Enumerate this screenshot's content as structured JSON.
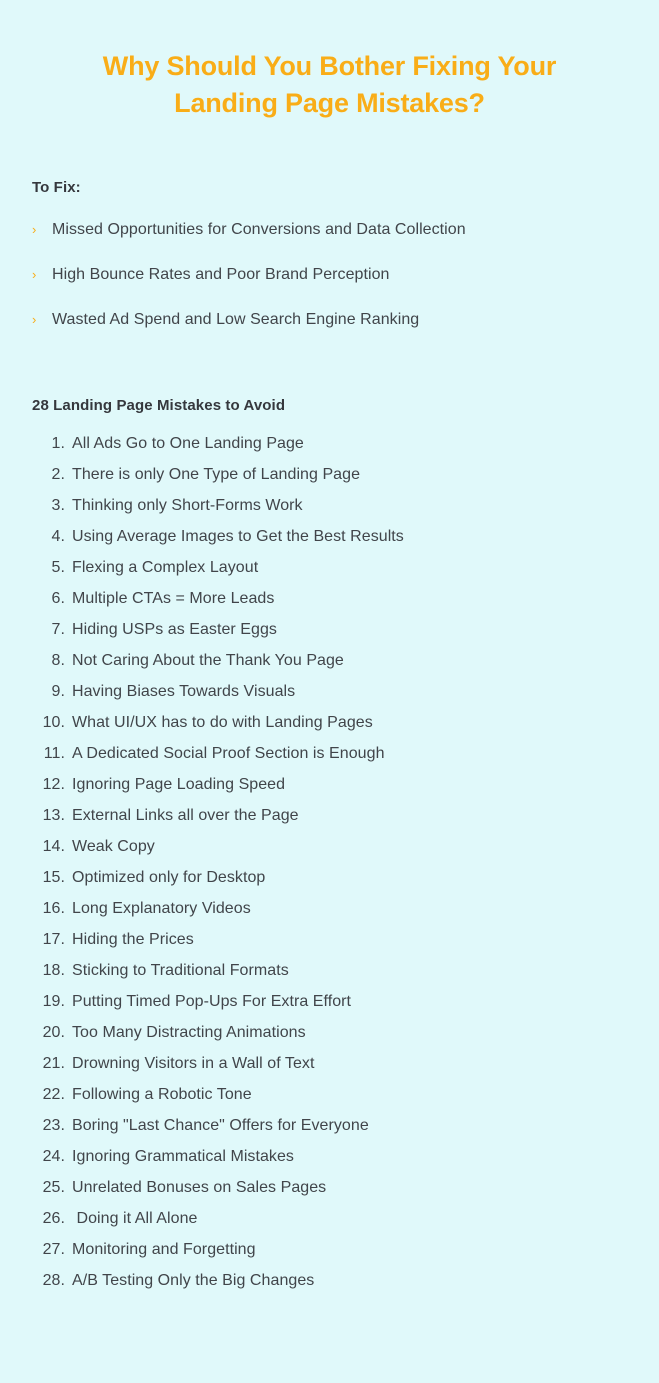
{
  "theme": {
    "background": "#e0f9fa",
    "accent": "#f9ad17",
    "text": "#41454a",
    "heading_text": "#35383d"
  },
  "title": "Why Should You Bother Fixing Your Landing Page Mistakes?",
  "to_fix": {
    "label": "To Fix:",
    "bullet_glyph": "›",
    "items": [
      "Missed Opportunities for Conversions and Data Collection",
      "High Bounce Rates and Poor Brand Perception",
      "Wasted Ad Spend and Low Search Engine Ranking"
    ]
  },
  "mistakes": {
    "heading": "28 Landing Page Mistakes to Avoid",
    "items": [
      {
        "number": "1.",
        "text": "All Ads Go to One Landing Page"
      },
      {
        "number": "2.",
        "text": "There is only One Type of Landing Page"
      },
      {
        "number": "3.",
        "text": "Thinking only Short-Forms Work"
      },
      {
        "number": "4.",
        "text": "Using Average Images to Get the Best Results"
      },
      {
        "number": "5.",
        "text": "Flexing a Complex Layout"
      },
      {
        "number": "6.",
        "text": "Multiple CTAs = More Leads"
      },
      {
        "number": "7.",
        "text": "Hiding USPs as Easter Eggs"
      },
      {
        "number": "8.",
        "text": "Not Caring About the Thank You Page"
      },
      {
        "number": "9.",
        "text": "Having Biases Towards Visuals"
      },
      {
        "number": "10.",
        "text": "What UI/UX has to do with Landing Pages"
      },
      {
        "number": "11.",
        "text": "A Dedicated Social Proof Section is Enough"
      },
      {
        "number": "12.",
        "text": "Ignoring Page Loading Speed"
      },
      {
        "number": "13.",
        "text": "External Links all over the Page"
      },
      {
        "number": "14.",
        "text": "Weak Copy"
      },
      {
        "number": "15.",
        "text": "Optimized only for Desktop"
      },
      {
        "number": "16.",
        "text": "Long Explanatory Videos"
      },
      {
        "number": "17.",
        "text": "Hiding the Prices"
      },
      {
        "number": "18.",
        "text": "Sticking to Traditional Formats"
      },
      {
        "number": "19.",
        "text": "Putting Timed Pop-Ups For Extra Effort"
      },
      {
        "number": "20.",
        "text": "Too Many Distracting Animations"
      },
      {
        "number": "21.",
        "text": "Drowning Visitors in a Wall of Text"
      },
      {
        "number": "22.",
        "text": "Following a Robotic Tone"
      },
      {
        "number": "23.",
        "text": "Boring \"Last Chance\" Offers for Everyone"
      },
      {
        "number": "24.",
        "text": "Ignoring Grammatical Mistakes"
      },
      {
        "number": "25.",
        "text": "Unrelated Bonuses on Sales Pages"
      },
      {
        "number": "26.",
        "text": " Doing it All Alone"
      },
      {
        "number": "27.",
        "text": "Monitoring and Forgetting"
      },
      {
        "number": "28.",
        "text": "A/B Testing Only the Big Changes"
      }
    ]
  }
}
